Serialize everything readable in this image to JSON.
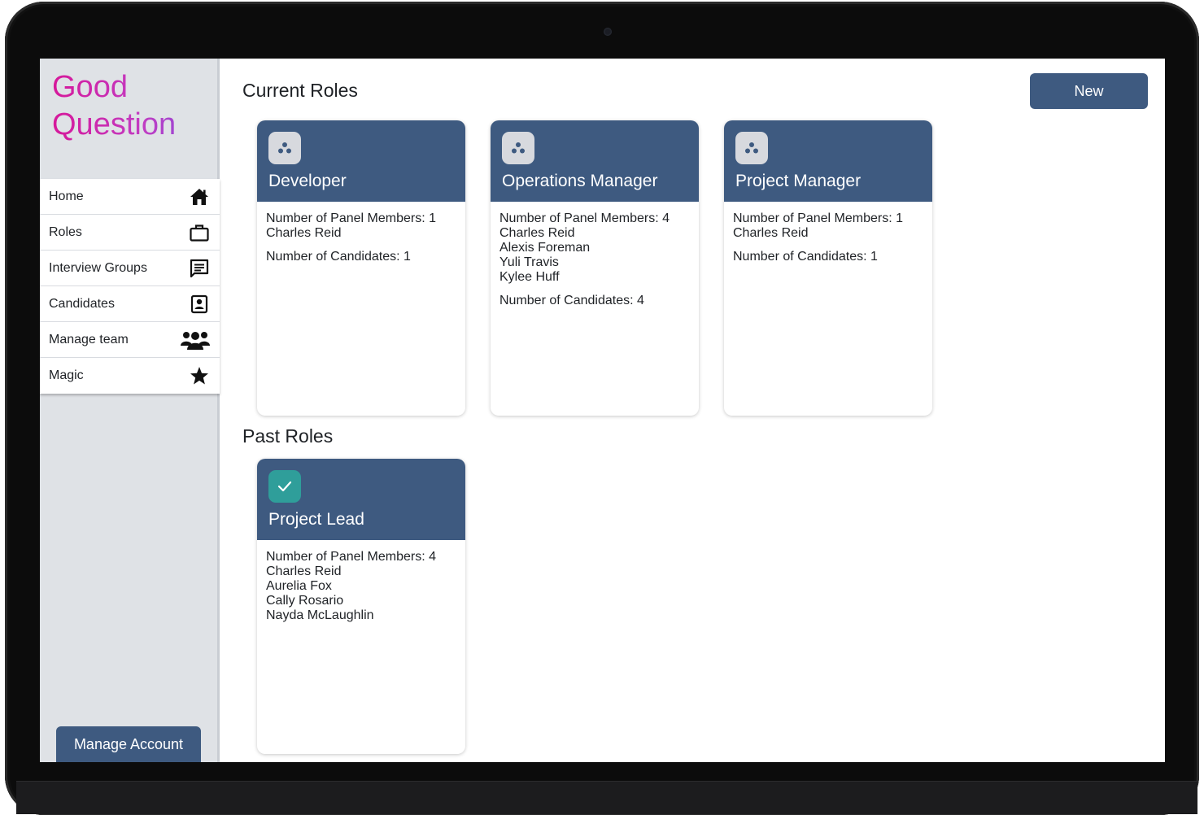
{
  "app": {
    "logo_line1": "Good",
    "logo_line2": "Question",
    "accent": "#3e5a80",
    "logo_gradient": [
      "#d6189a",
      "#7f4fe0"
    ]
  },
  "sidebar": {
    "items": [
      {
        "label": "Home",
        "icon": "home-icon"
      },
      {
        "label": "Roles",
        "icon": "briefcase-icon"
      },
      {
        "label": "Interview Groups",
        "icon": "chat-icon"
      },
      {
        "label": "Candidates",
        "icon": "contact-card-icon"
      },
      {
        "label": "Manage team",
        "icon": "team-icon"
      },
      {
        "label": "Magic",
        "icon": "star-icon"
      }
    ],
    "manage_account": "Manage Account"
  },
  "main": {
    "current_title": "Current Roles",
    "past_title": "Past Roles",
    "new_button": "New",
    "current_roles": [
      {
        "title": "Developer",
        "icon": "group-dots-icon",
        "panel_label": "Number of Panel Members: 1",
        "members": [
          "Charles Reid"
        ],
        "candidates_label": "Number of Candidates: 1"
      },
      {
        "title": "Operations Manager",
        "icon": "group-dots-icon",
        "panel_label": "Number of Panel Members: 4",
        "members": [
          "Charles Reid",
          "Alexis Foreman",
          "Yuli Travis",
          "Kylee Huff"
        ],
        "candidates_label": "Number of Candidates: 4"
      },
      {
        "title": "Project Manager",
        "icon": "group-dots-icon",
        "panel_label": "Number of Panel Members: 1",
        "members": [
          "Charles Reid"
        ],
        "candidates_label": "Number of Candidates: 1"
      }
    ],
    "past_roles": [
      {
        "title": "Project Lead",
        "icon": "check-icon",
        "panel_label": "Number of Panel Members: 4",
        "members": [
          "Charles Reid",
          "Aurelia Fox",
          "Cally Rosario",
          "Nayda McLaughlin"
        ]
      }
    ]
  }
}
